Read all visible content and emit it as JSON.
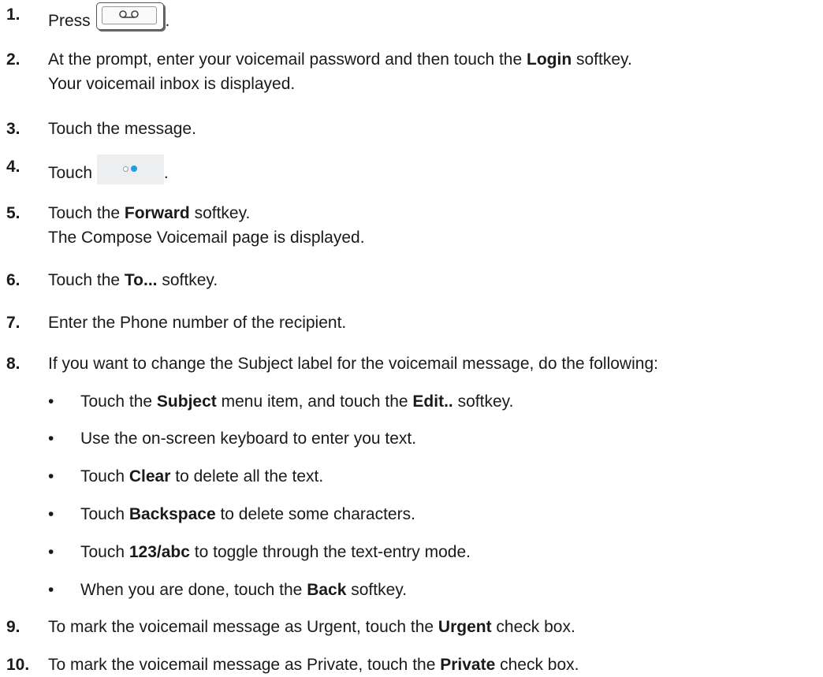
{
  "steps": [
    {
      "num": "1.",
      "pre": "Press",
      "post": "."
    },
    {
      "num": "2.",
      "pre": "At the prompt, enter your voicemail password and then touch the ",
      "bold": "Login",
      "post": " softkey.",
      "line2": "Your voicemail inbox is displayed."
    },
    {
      "num": "3.",
      "text": "Touch the message."
    },
    {
      "num": "4.",
      "pre": "Touch",
      "post": "."
    },
    {
      "num": "5.",
      "pre": "Touch the ",
      "bold": "Forward",
      "post": " softkey.",
      "line2": "The Compose Voicemail page is displayed."
    },
    {
      "num": "6.",
      "pre": "Touch the ",
      "bold": "To...",
      "post": " softkey."
    },
    {
      "num": "7.",
      "text": "Enter the Phone number of the recipient."
    },
    {
      "num": "8.",
      "text": "If you want to change the Subject label for the voicemail message, do the following:"
    },
    {
      "num": "9.",
      "pre": "To mark the voicemail message as Urgent, touch the ",
      "bold": "Urgent",
      "post": " check box."
    },
    {
      "num": "10.",
      "pre": "To mark the voicemail message as Private, touch the ",
      "bold": "Private",
      "post": " check box."
    }
  ],
  "bullets": [
    {
      "bullet": "•",
      "pre": "Touch the ",
      "bold": "Subject",
      "mid": " menu item, and touch the ",
      "bold2": "Edit..",
      "post": " softkey."
    },
    {
      "bullet": "•",
      "text": "Use the on-screen keyboard to enter you text."
    },
    {
      "bullet": "•",
      "pre": "Touch ",
      "bold": "Clear",
      "post": " to delete all the text."
    },
    {
      "bullet": "•",
      "pre": "Touch ",
      "bold": "Backspace",
      "post": " to delete some characters."
    },
    {
      "bullet": "•",
      "pre": "Touch ",
      "bold": "123/abc",
      "post": " to toggle through the text-entry mode."
    },
    {
      "bullet": "•",
      "pre": "When you are done, touch the ",
      "bold": "Back",
      "post": " softkey."
    }
  ],
  "icons": {
    "step1": "voicemail-key-icon",
    "step4": "more-dots-icon",
    "dot_accent": "#1ea0e6"
  }
}
